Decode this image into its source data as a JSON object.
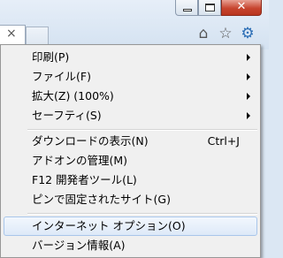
{
  "titlebar": {
    "minimize_icon": "minimize-icon",
    "maximize_icon": "maximize-icon",
    "close_icon": "close-icon",
    "close_glyph": "✕"
  },
  "tabs": {
    "close_glyph": "×"
  },
  "toolbar": {
    "home_icon": "home-icon",
    "home_glyph": "⌂",
    "favorites_icon": "star-icon",
    "favorites_glyph": "☆",
    "tools_icon": "gear-icon",
    "tools_glyph": "⚙"
  },
  "menu": {
    "group1": [
      {
        "label": "印刷(P)",
        "submenu": true
      },
      {
        "label": "ファイル(F)",
        "submenu": true
      },
      {
        "label": "拡大(Z) (100%)",
        "submenu": true
      },
      {
        "label": "セーフティ(S)",
        "submenu": true
      }
    ],
    "group2": [
      {
        "label": "ダウンロードの表示(N)",
        "shortcut": "Ctrl+J"
      },
      {
        "label": "アドオンの管理(M)"
      },
      {
        "label": "F12 開発者ツール(L)"
      },
      {
        "label": "ピンで固定されたサイト(G)"
      }
    ],
    "group3": [
      {
        "label": "インターネット オプション(O)",
        "highlighted": true
      },
      {
        "label": "バージョン情報(A)"
      }
    ]
  },
  "colors": {
    "highlight_border": "#a9c6ea",
    "close_button": "#c7452f"
  }
}
